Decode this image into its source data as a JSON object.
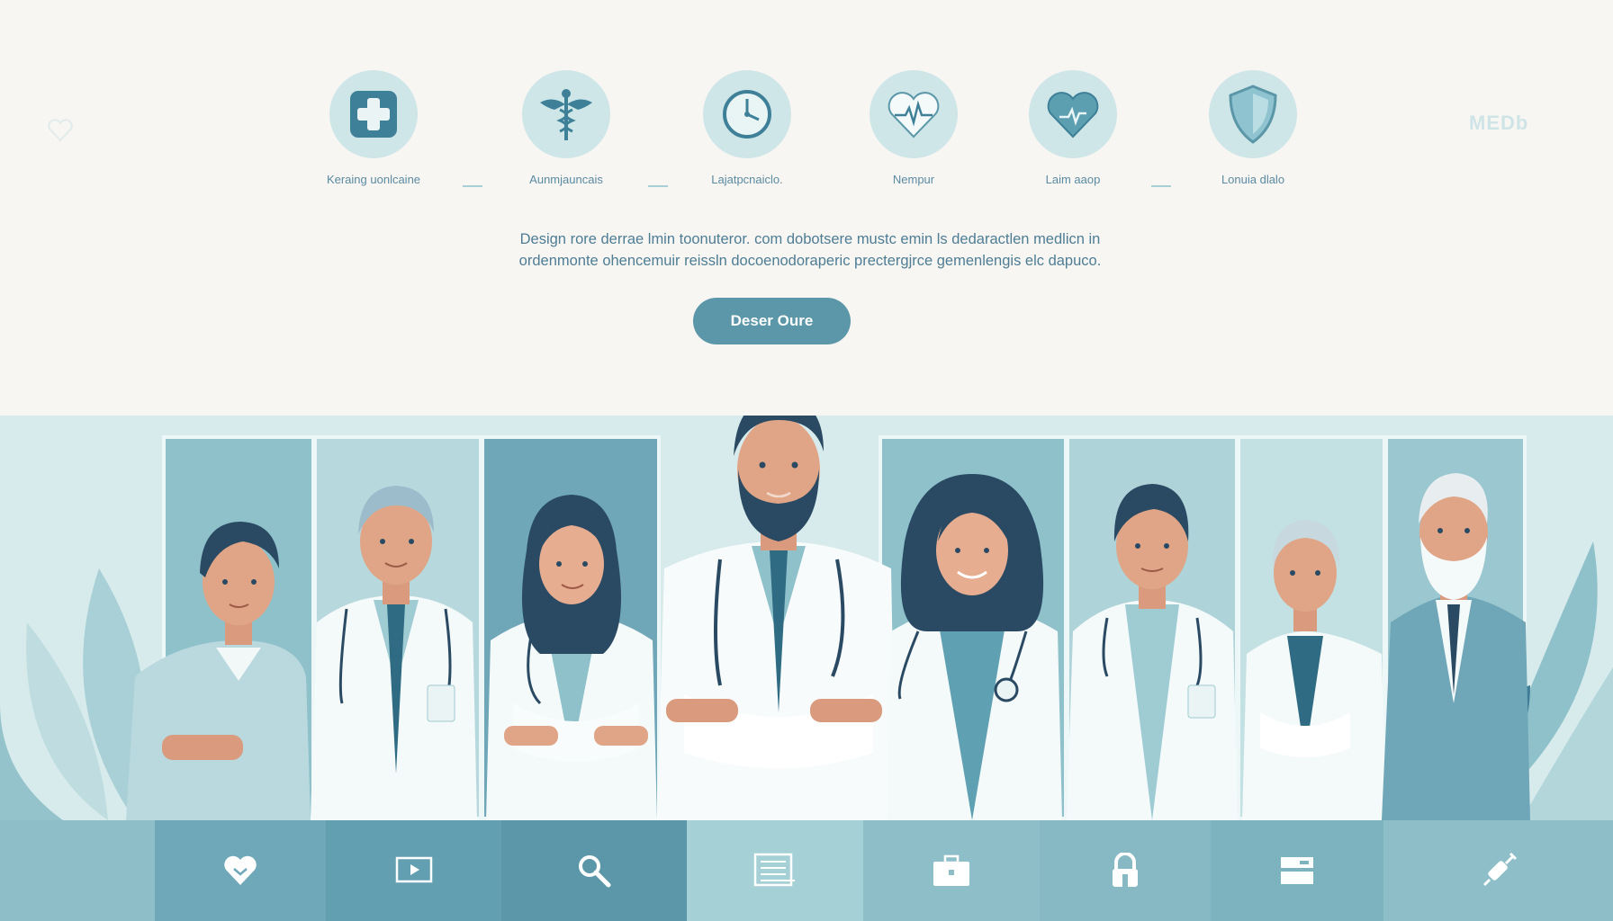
{
  "header": {
    "brand": "MEDb"
  },
  "features": [
    {
      "icon": "medical-cross-icon",
      "label": "Keraing uonlcaine"
    },
    {
      "icon": "caduceus-icon",
      "label": "Aunmjauncais"
    },
    {
      "icon": "clock-icon",
      "label": "Lajatpcnaiclo."
    },
    {
      "icon": "heart-pulse-icon",
      "label": "Nempur"
    },
    {
      "icon": "heart-ecg-icon",
      "label": "Laim aaop"
    },
    {
      "icon": "shield-icon",
      "label": "Lonuia dlalo"
    }
  ],
  "description": {
    "line1": "Design rore derrae lmin toonuteror. com dobotsere mustc emin ls dedaractlen medlicn in",
    "line2": "ordenmonte ohencemuir reissln docoenodoraperic prectergjrce gemenlengis elc dapuco."
  },
  "cta": {
    "label": "Deser Oure"
  },
  "colors": {
    "accent": "#5b97a8",
    "dark_teal": "#2f6c84",
    "icon_bg": "#cfe6e8",
    "panel_light": "#a9d1d6",
    "panel_mid": "#7fb5c2",
    "hair": "#2a4a63"
  },
  "toolbar": [
    {
      "icon": "heart-icon"
    },
    {
      "icon": "video-icon"
    },
    {
      "icon": "search-icon"
    },
    {
      "icon": "document-icon"
    },
    {
      "icon": "briefcase-icon"
    },
    {
      "icon": "lock-icon"
    },
    {
      "icon": "card-icon"
    },
    {
      "icon": "syringe-icon"
    }
  ]
}
